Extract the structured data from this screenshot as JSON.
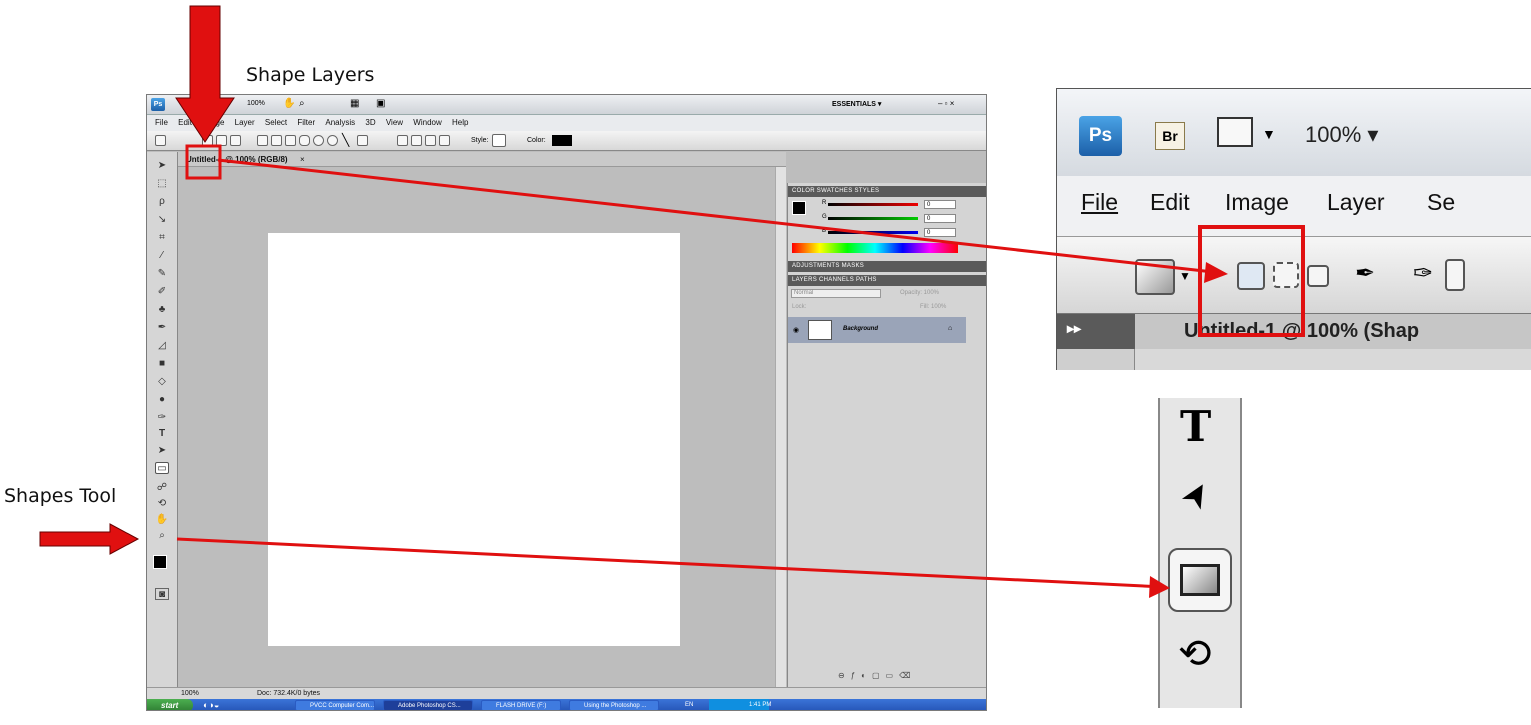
{
  "annotations": {
    "shape_layers_label": "Shape Layers",
    "shapes_tool_label": "Shapes Tool"
  },
  "main": {
    "app_logo": "Ps",
    "zoom": "100%",
    "workspace": "ESSENTIALS ▾",
    "window_controls": "– ▫ ×",
    "menu": [
      "File",
      "Edit",
      "Image",
      "Layer",
      "Select",
      "Filter",
      "Analysis",
      "3D",
      "View",
      "Window",
      "Help"
    ],
    "options": {
      "style_label": "Style:",
      "color_label": "Color:"
    },
    "doc_tab": "Untitled-1 @ 100% (RGB/8)",
    "doc_tab_close": "×",
    "panels": {
      "color_tabs": "COLOR   SWATCHES   STYLES",
      "r_label": "R",
      "g_label": "G",
      "b_label": "B",
      "r_value": "0",
      "g_value": "0",
      "b_value": "0",
      "adjust_tabs": "ADJUSTMENTS   MASKS",
      "layers_tabs": "LAYERS   CHANNELS   PATHS",
      "blend_mode": "Normal",
      "opacity": "Opacity: 100%",
      "lock": "Lock:",
      "fill": "Fill: 100%",
      "layer_name": "Background"
    },
    "status": {
      "zoom": "100%",
      "doc": "Doc: 732.4K/0 bytes"
    },
    "taskbar": {
      "start": "start",
      "items": [
        "PVCC Computer Com...",
        "Adobe Photoshop CS...",
        "FLASH DRIVE (F:)",
        "Using the Photoshop ..."
      ],
      "lang": "EN",
      "time": "1:41 PM"
    }
  },
  "zoom_top": {
    "ps": "Ps",
    "br": "Br",
    "zoom": "100% ▾",
    "menu": [
      "File",
      "Edit",
      "Image",
      "Layer",
      "Se"
    ],
    "doc_title": "Untitled-1 @ 100% (Shap"
  },
  "colors": {
    "annotation_red": "#e01010",
    "ps_blue": "#1c5fa8"
  }
}
